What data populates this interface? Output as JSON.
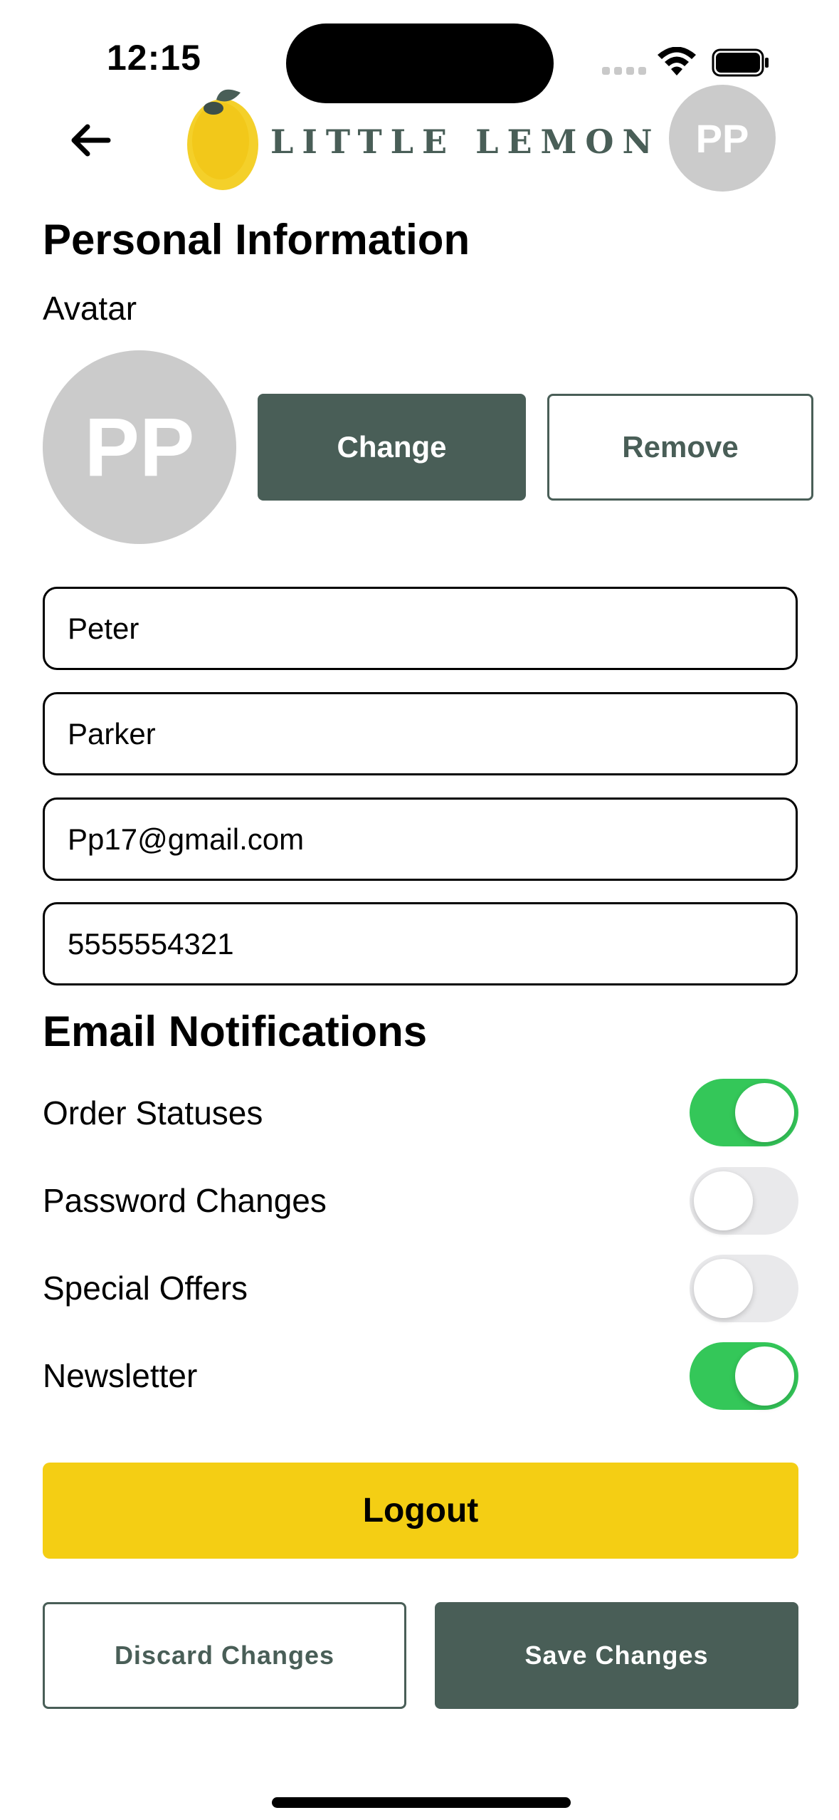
{
  "status_bar": {
    "time": "12:15"
  },
  "header": {
    "back_icon": "arrow-left-icon",
    "logo_text": "LITTLE LEMON",
    "avatar_initials": "PP"
  },
  "personal_info": {
    "title": "Personal Information",
    "avatar_label": "Avatar",
    "avatar_initials": "PP",
    "change_label": "Change",
    "remove_label": "Remove",
    "fields": {
      "first_name": "Peter",
      "last_name": "Parker",
      "email": "Pp17@gmail.com",
      "phone": "5555554321"
    }
  },
  "email_notifications": {
    "title": "Email Notifications",
    "items": [
      {
        "label": "Order Statuses",
        "enabled": true
      },
      {
        "label": "Password Changes",
        "enabled": false
      },
      {
        "label": "Special Offers",
        "enabled": false
      },
      {
        "label": "Newsletter",
        "enabled": true
      }
    ]
  },
  "actions": {
    "logout_label": "Logout",
    "discard_label": "Discard Changes",
    "save_label": "Save Changes"
  },
  "colors": {
    "primary_green": "#495e57",
    "accent_yellow": "#f4ce14",
    "toggle_on": "#34c759",
    "toggle_off": "#e9e9eb",
    "avatar_gray": "#cbcbcb"
  }
}
